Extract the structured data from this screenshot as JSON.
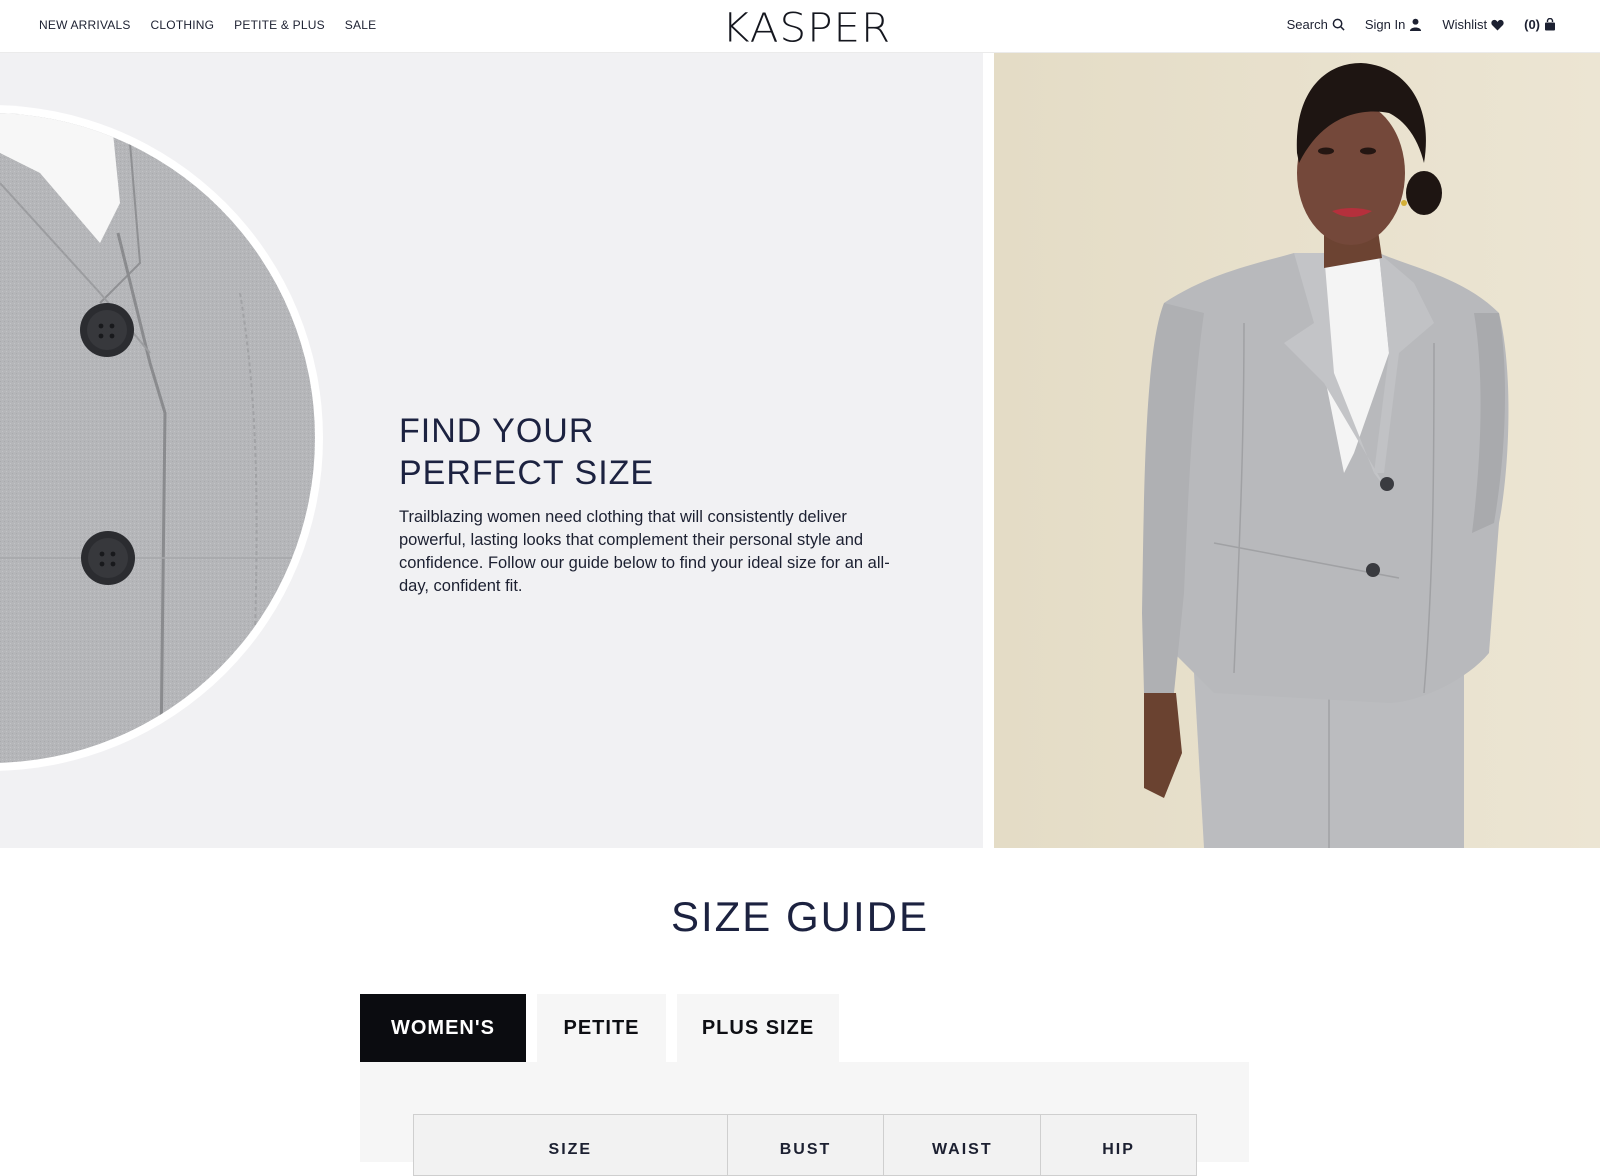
{
  "header": {
    "nav_left": [
      "NEW ARRIVALS",
      "CLOTHING",
      "PETITE & PLUS",
      "SALE"
    ],
    "logo": "KASPER",
    "search_label": "Search",
    "sign_in_label": "Sign In",
    "wishlist_label": "Wishlist",
    "cart_count": "(0)"
  },
  "hero": {
    "title_line1": "FIND YOUR",
    "title_line2": "PERFECT SIZE",
    "description": "Trailblazing women need clothing that will consistently deliver powerful, lasting looks that complement their personal style and confidence. Follow our guide below to find your ideal size for an all-day, confident fit."
  },
  "size_guide": {
    "title": "SIZE GUIDE",
    "tabs": [
      "WOMEN'S",
      "PETITE",
      "PLUS SIZE"
    ],
    "active_tab": "WOMEN'S",
    "table_headers": [
      "SIZE",
      "BUST",
      "WAIST",
      "HIP"
    ]
  },
  "colors": {
    "accent_dark": "#0b0c10",
    "heading": "#1c2240",
    "hero_bg": "#f1f1f3",
    "suit_gray": "#b3b4b7"
  },
  "icons": [
    "search-icon",
    "user-icon",
    "heart-icon",
    "bag-icon"
  ]
}
